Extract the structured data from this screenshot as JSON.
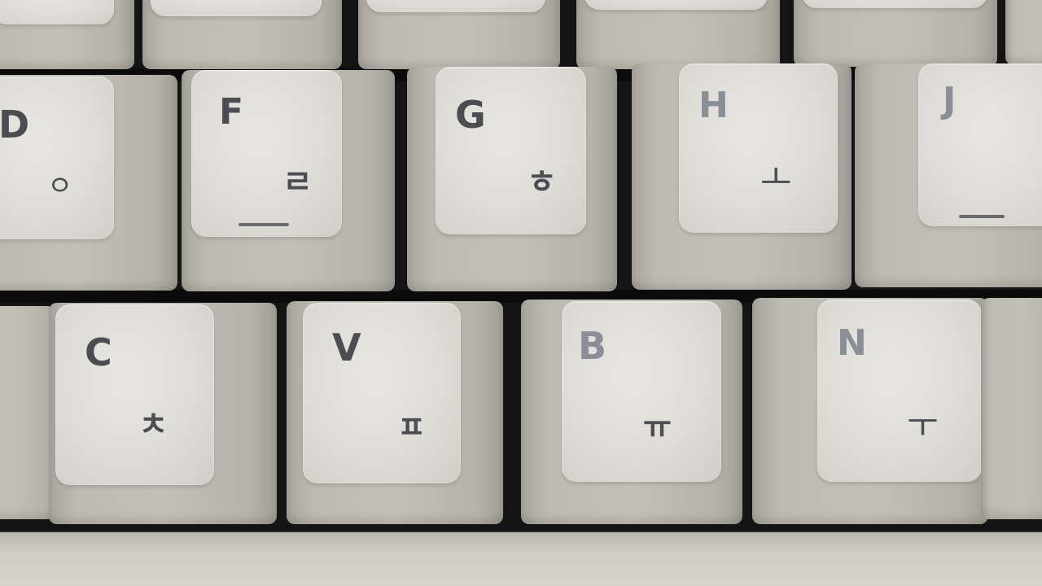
{
  "keyboard": {
    "top_row": [
      {
        "id": "top-1"
      },
      {
        "id": "top-2"
      },
      {
        "id": "top-3"
      },
      {
        "id": "top-4"
      },
      {
        "id": "top-5"
      },
      {
        "id": "top-6"
      }
    ],
    "home_row": [
      {
        "letter": "D",
        "hangul": "ㅇ"
      },
      {
        "letter": "F",
        "hangul": "ㄹ"
      },
      {
        "letter": "G",
        "hangul": "ㅎ"
      },
      {
        "letter": "H",
        "hangul": "ㅗ"
      },
      {
        "letter": "J",
        "hangul": ""
      }
    ],
    "bottom_row": [
      {
        "letter": "C",
        "hangul": "ㅊ"
      },
      {
        "letter": "V",
        "hangul": "ㅍ"
      },
      {
        "letter": "B",
        "hangul": "ㅠ"
      },
      {
        "letter": "N",
        "hangul": "ㅜ"
      }
    ],
    "colors": {
      "keycap_top": "#dedcd6",
      "keycap_side": "#bdbab1",
      "legend_ink": "#4b4d52",
      "gap": "#141414"
    }
  }
}
